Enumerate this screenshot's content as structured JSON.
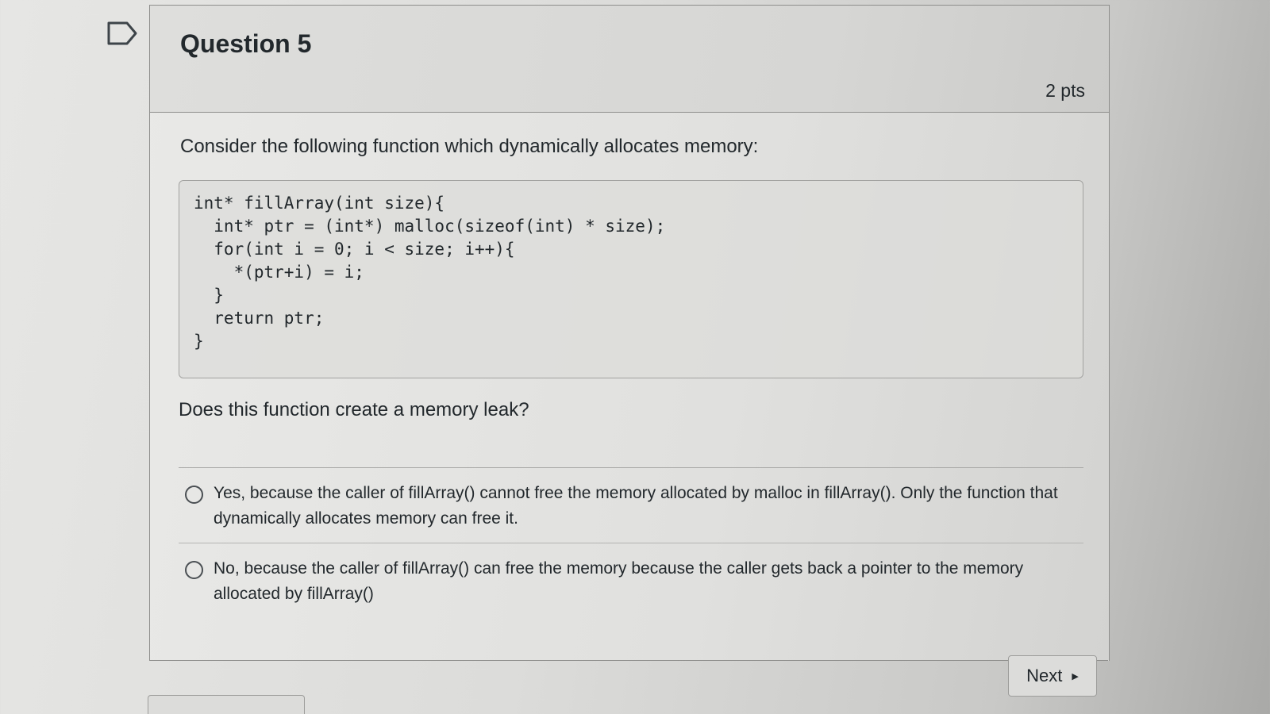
{
  "question": {
    "title": "Question 5",
    "points": "2 pts",
    "intro": "Consider the following function which dynamically allocates memory:",
    "code": "int* fillArray(int size){\n  int* ptr = (int*) malloc(sizeof(int) * size);\n  for(int i = 0; i < size; i++){\n    *(ptr+i) = i;\n  }\n  return ptr;\n}",
    "prompt": "Does this function create a memory leak?",
    "answers": [
      {
        "label": "Yes, because the caller of fillArray() cannot free the memory allocated by malloc in fillArray(). Only the function that dynamically allocates memory can free it.",
        "selected": false
      },
      {
        "label": "No, because the caller of fillArray() can free the memory because the caller gets back a pointer to the memory allocated by fillArray()",
        "selected": false
      }
    ]
  },
  "navigation": {
    "next_label": "Next"
  },
  "icons": {
    "flag": "flag-icon",
    "next_arrow": "triangle-right-icon",
    "radio": "radio-unchecked-icon"
  }
}
